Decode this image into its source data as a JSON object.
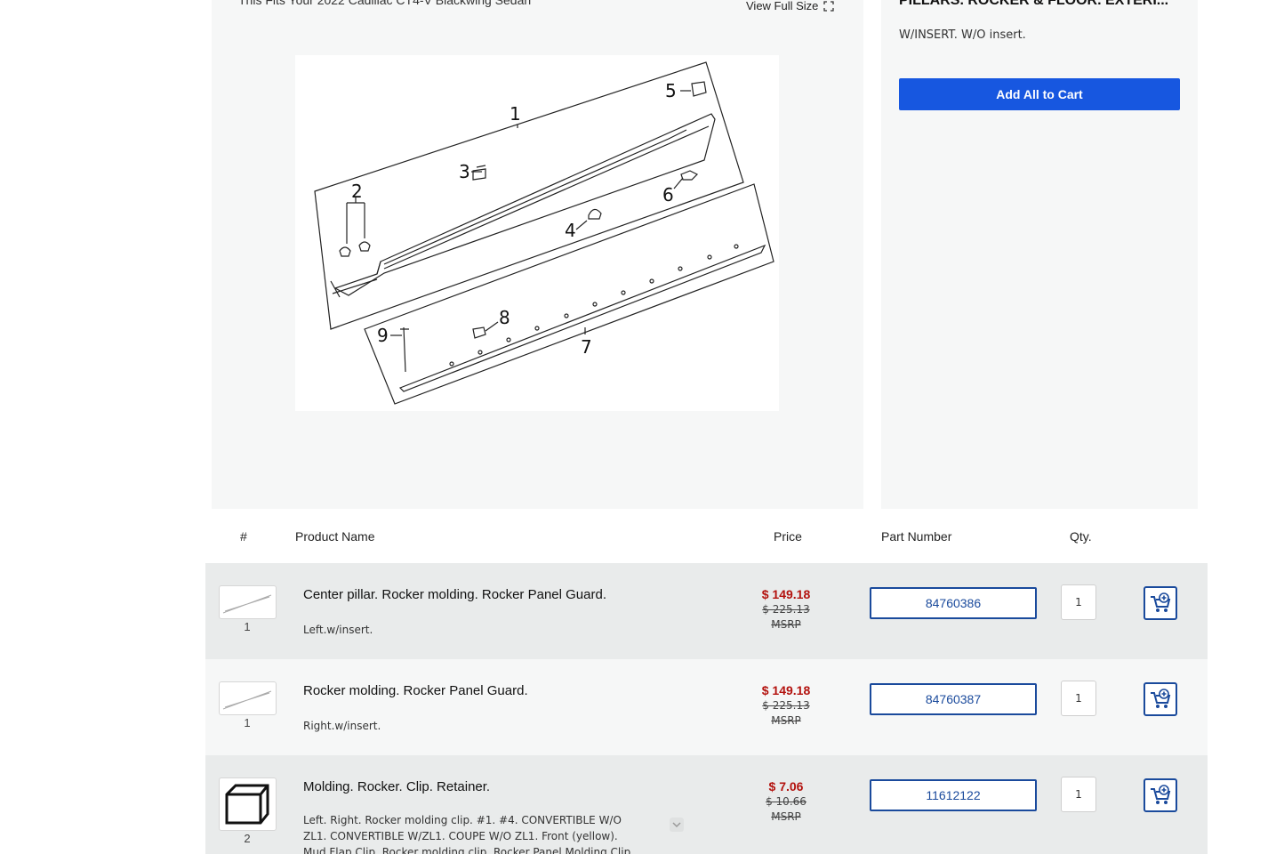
{
  "header": {
    "fit_text": "This Fits Your 2022 Cadillac CT4-V Blackwing Sedan",
    "view_full_size": "View Full Size"
  },
  "diagram": {
    "callouts": [
      "1",
      "2",
      "3",
      "4",
      "5",
      "6",
      "7",
      "8",
      "9"
    ]
  },
  "summary": {
    "title": "PILLARS. ROCKER & FLOOR. EXTERI...",
    "description": "W/INSERT. W/O insert.",
    "add_all_label": "Add All to Cart"
  },
  "table": {
    "headers": {
      "num": "#",
      "name": "Product Name",
      "price": "Price",
      "part": "Part Number",
      "qty": "Qty."
    },
    "rows": [
      {
        "callout": "1",
        "name": "Center pillar. Rocker molding. Rocker Panel Guard.",
        "desc": "Left.w/insert.",
        "price": "$ 149.18",
        "msrp_value": "$ 225.13",
        "msrp_label": "MSRP",
        "part_number": "84760386",
        "qty": "1"
      },
      {
        "callout": "1",
        "name": "Rocker molding. Rocker Panel Guard.",
        "desc": "Right.w/insert.",
        "price": "$ 149.18",
        "msrp_value": "$ 225.13",
        "msrp_label": "MSRP",
        "part_number": "84760387",
        "qty": "1"
      },
      {
        "callout": "2",
        "name": "Molding. Rocker. Clip. Retainer.",
        "desc": "Left. Right. Rocker molding clip. #1. #4. CONVERTIBLE W/O ZL1. CONVERTIBLE W/ZL1. COUPE W/O ZL1. Front (yellow). Mud Flap Clip. Rocker molding clip. Rocker Panel Molding Clip.",
        "price": "$ 7.06",
        "msrp_value": "$ 10.66",
        "msrp_label": "MSRP",
        "part_number": "11612122",
        "qty": "1"
      }
    ]
  },
  "colors": {
    "accent": "#1757e0",
    "part_border": "#1a4a9c",
    "price": "#b3120e"
  }
}
